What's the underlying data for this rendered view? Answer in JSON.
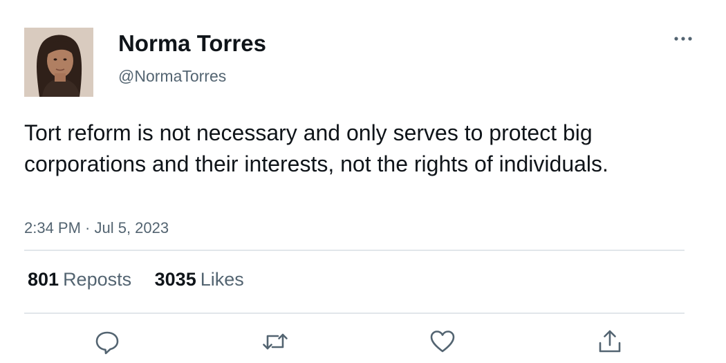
{
  "tweet": {
    "author": {
      "display_name": "Norma Torres",
      "handle": "@NormaTorres"
    },
    "text": "Tort reform is not necessary and only serves to protect big corporations and their interests, not the rights of individuals.",
    "timestamp": "2:34 PM · Jul 5, 2023",
    "stats": {
      "reposts_count": "801",
      "reposts_label": "Reposts",
      "likes_count": "3035",
      "likes_label": "Likes"
    },
    "actions": [
      {
        "name": "reply",
        "icon": "speech-bubble-icon"
      },
      {
        "name": "repost",
        "icon": "repost-arrows-icon"
      },
      {
        "name": "like",
        "icon": "heart-icon"
      },
      {
        "name": "share",
        "icon": "share-upload-icon"
      }
    ]
  },
  "colors": {
    "text_primary": "#0f1419",
    "text_secondary": "#536471",
    "divider": "#e1e6ea",
    "background": "#ffffff"
  }
}
